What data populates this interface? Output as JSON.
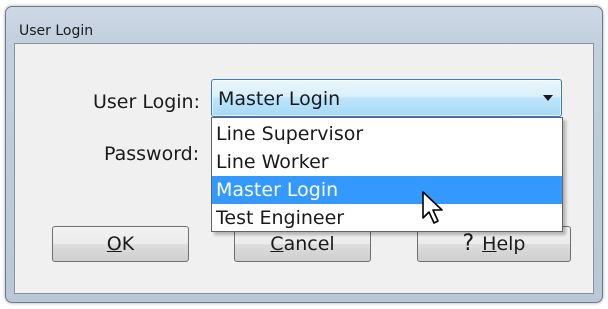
{
  "window": {
    "title": "User Login"
  },
  "form": {
    "user_login_label": "User Login:",
    "password_label": "Password:"
  },
  "user_login_combo": {
    "selected": "Master Login",
    "options": [
      "Line Supervisor",
      "Line Worker",
      "Master Login",
      "Test Engineer"
    ],
    "highlighted_index": 2
  },
  "buttons": {
    "ok": {
      "accel": "O",
      "rest": "K"
    },
    "cancel": {
      "accel": "C",
      "rest": "ancel"
    },
    "help": {
      "icon": "?",
      "accel": "H",
      "rest": "elp"
    }
  },
  "icons": {
    "dropdown_arrow": "chevron-down-icon",
    "pointer": "mouse-pointer-icon",
    "help": "question-mark-icon"
  },
  "colors": {
    "highlight": "#3399ff",
    "combo_border": "#3a7ac0"
  }
}
